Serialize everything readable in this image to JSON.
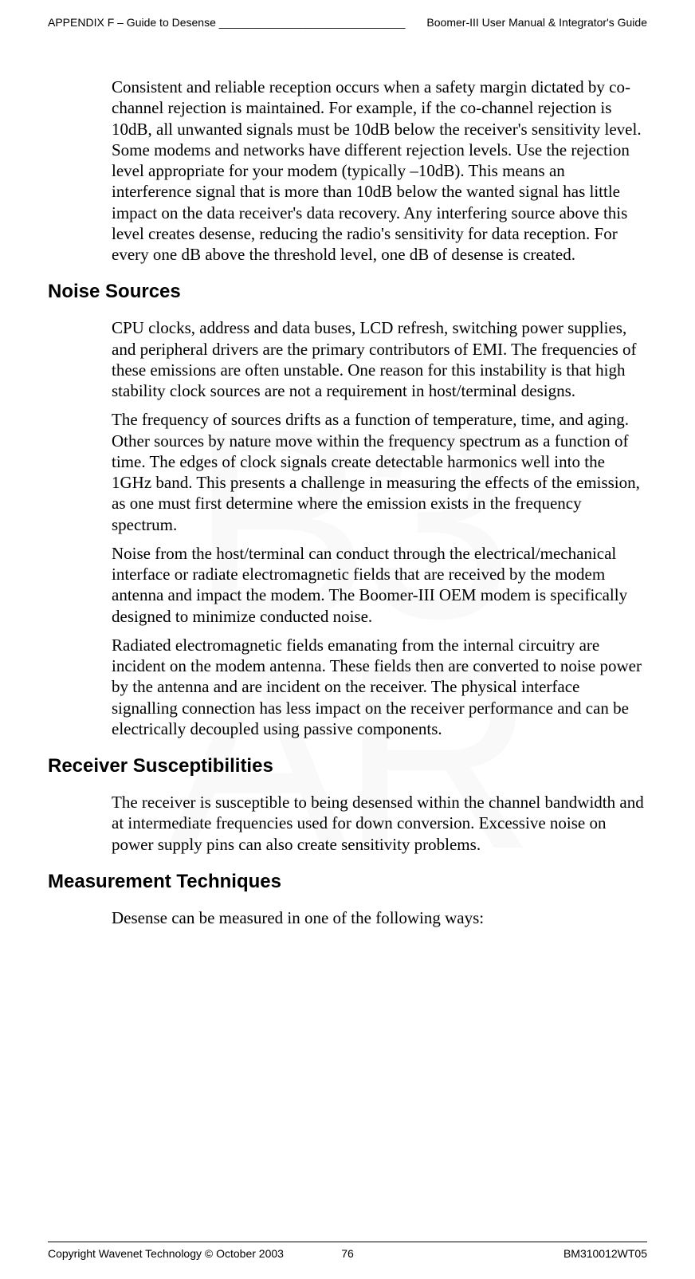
{
  "header": {
    "left": "APPENDIX F – Guide to Desense ______________________________",
    "right": "Boomer-III User Manual & Integrator's Guide"
  },
  "watermark": {
    "line1": "B3",
    "line2": "AR"
  },
  "section_intro": {
    "p1": "Consistent and reliable reception occurs when a safety margin dictated by co-channel rejection is maintained. For example, if the co-channel rejection is 10dB, all unwanted signals must be 10dB below the receiver's sensitivity level. Some modems and networks have different rejection levels. Use the rejection level appropriate for your modem (typically –10dB). This means an interference signal that is more than 10dB below the wanted signal has little impact on the data receiver's data recovery. Any interfering source above this level creates desense, reducing the radio's sensitivity for data reception. For every one dB above the threshold level, one dB of desense is created."
  },
  "section_noise": {
    "heading": "Noise Sources",
    "p1": "CPU clocks, address and data buses, LCD refresh, switching power supplies, and peripheral drivers are the primary contributors of EMI. The frequencies of these emissions are often unstable. One reason for this instability is that high stability clock sources are not a requirement in host/terminal designs.",
    "p2": "The frequency of sources drifts as a function of temperature, time, and aging. Other sources by nature move within the frequency spectrum as a function of time. The edges of clock signals create detectable harmonics well into the 1GHz band. This presents a challenge in measuring the effects of the emission, as one must first determine where the emission exists in the frequency spectrum.",
    "p3": "Noise from the host/terminal can conduct through the electrical/mechanical interface or radiate electromagnetic fields that are received by the modem antenna and impact the modem. The Boomer-III OEM modem is specifically designed to minimize conducted noise.",
    "p4": "Radiated electromagnetic fields emanating from the internal circuitry are incident on the modem antenna. These fields then are converted to noise power by the antenna and are incident on the receiver. The physical interface signalling connection has less impact on the receiver performance and can be electrically decoupled using passive components."
  },
  "section_receiver": {
    "heading": "Receiver Susceptibilities",
    "p1": "The receiver is susceptible to being desensed within the channel bandwidth and at intermediate frequencies used for down conversion. Excessive noise on power supply pins can also create sensitivity problems."
  },
  "section_measurement": {
    "heading": "Measurement Techniques",
    "p1": "Desense can be measured in one of the following ways:"
  },
  "footer": {
    "left": "Copyright Wavenet Technology © October 2003",
    "center": "76",
    "right": "BM310012WT05"
  }
}
